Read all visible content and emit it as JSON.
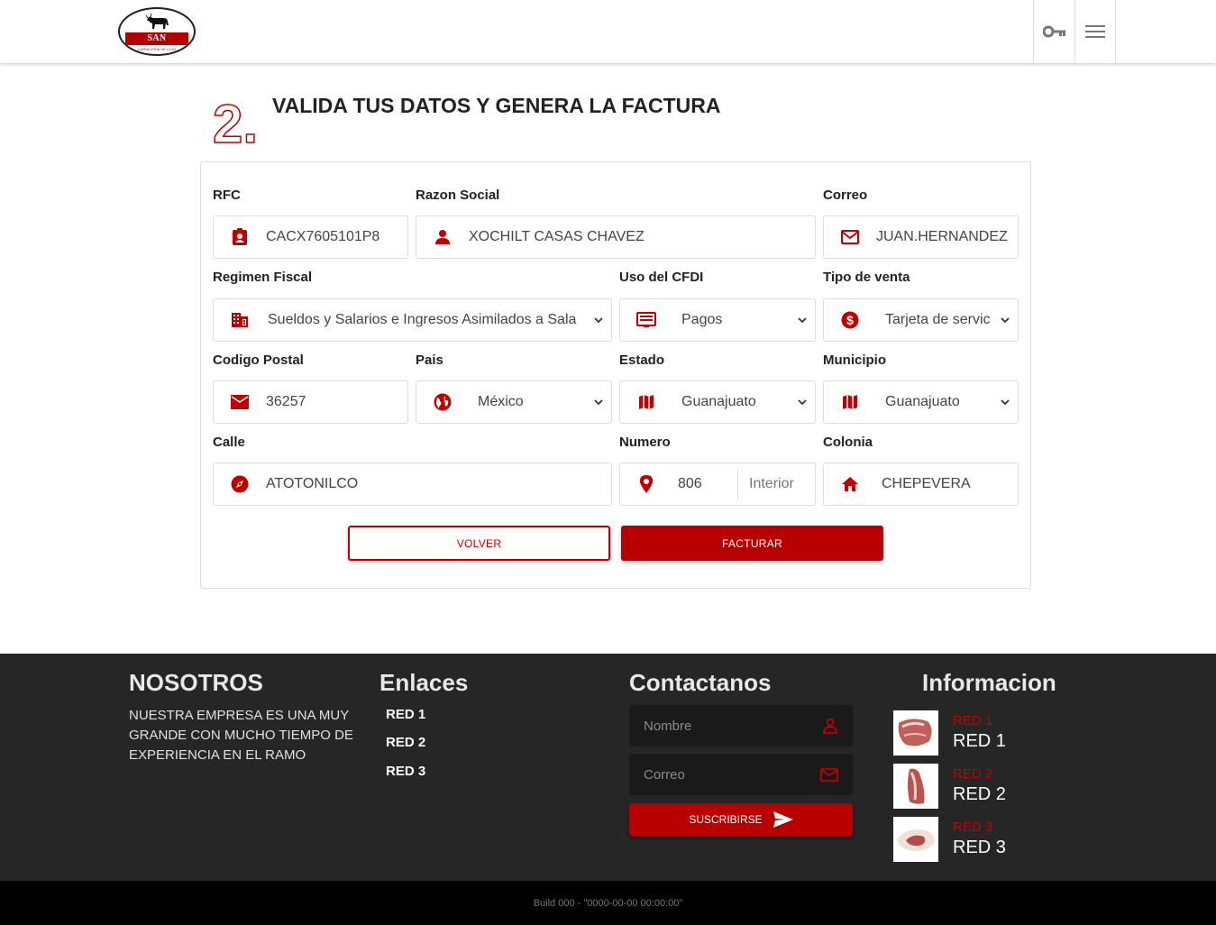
{
  "header": {
    "logo_text": "SAN GABRIEL",
    "logo_subtext": "CARNICERÍA DE LUJO"
  },
  "step": {
    "number": "2.",
    "title": "VALIDA TUS DATOS Y GENERA LA FACTURA"
  },
  "form": {
    "rfc": {
      "label": "RFC",
      "value": "CACX7605101P8"
    },
    "razon_social": {
      "label": "Razon Social",
      "value": "XOCHILT CASAS CHAVEZ"
    },
    "correo": {
      "label": "Correo",
      "value": "JUAN.HERNANDEZ"
    },
    "regimen_fiscal": {
      "label": "Regimen Fiscal",
      "value": "Sueldos y Salarios e Ingresos Asimilados a Sala"
    },
    "uso_cfdi": {
      "label": "Uso del CFDI",
      "value": "Pagos"
    },
    "tipo_venta": {
      "label": "Tipo de venta",
      "value": "Tarjeta de servic"
    },
    "codigo_postal": {
      "label": "Codigo Postal",
      "value": "36257"
    },
    "pais": {
      "label": "Pais",
      "value": "México"
    },
    "estado": {
      "label": "Estado",
      "value": "Guanajuato"
    },
    "municipio": {
      "label": "Municipio",
      "value": "Guanajuato"
    },
    "calle": {
      "label": "Calle",
      "value": "ATOTONILCO"
    },
    "numero": {
      "label": "Numero",
      "value": "806",
      "interior_placeholder": "Interior"
    },
    "colonia": {
      "label": "Colonia",
      "value": "CHEPEVERA"
    },
    "back_label": "VOLVER",
    "submit_label": "FACTURAR"
  },
  "footer": {
    "about_title": "NOSOTROS",
    "about_text": "NUESTRA EMPRESA ES UNA MUY GRANDE CON MUCHO TIEMPO DE EXPERIENCIA EN EL RAMO",
    "links_title": "Enlaces",
    "links": [
      "RED 1",
      "RED 2",
      "RED 3"
    ],
    "contact_title": "Contactanos",
    "name_placeholder": "Nombre",
    "email_placeholder": "Correo",
    "subscribe_label": "SUSCRIBIRSE",
    "info_title": "Informacion",
    "info_items": [
      {
        "small": "RED 1",
        "big": "RED 1"
      },
      {
        "small": "RED 2",
        "big": "RED 2"
      },
      {
        "small": "RED 3",
        "big": "RED 3"
      }
    ]
  },
  "build": "Build 000 - \"0000-00-00 00:00:00\"",
  "colors": {
    "accent": "#b80000",
    "footer_bg": "#262626",
    "bottom_bg": "#000000"
  }
}
